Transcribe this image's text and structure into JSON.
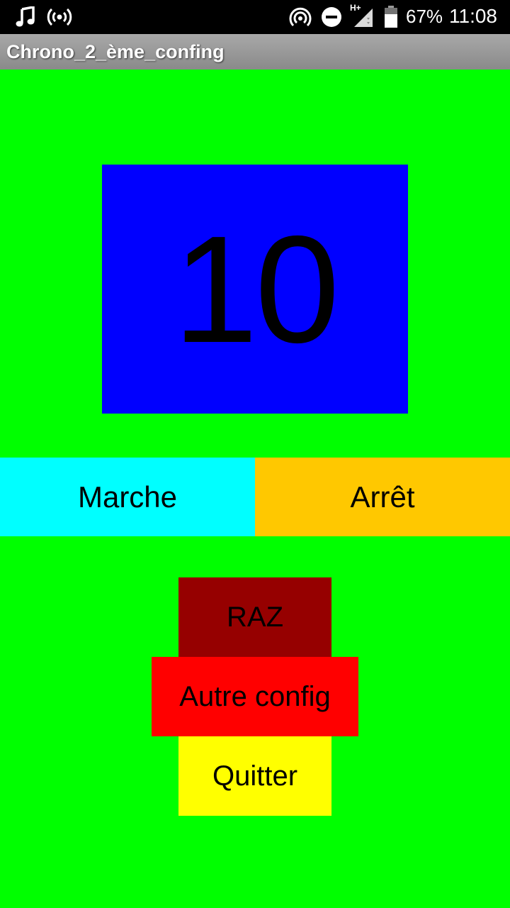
{
  "status_bar": {
    "battery_percent": "67%",
    "time": "11:08",
    "network_label": "H+",
    "icons": [
      "music-note-icon",
      "hotspot-icon",
      "nfc-icon",
      "do-not-disturb-icon",
      "signal-icon",
      "battery-icon"
    ]
  },
  "app": {
    "title": "Chrono_2_ème_confing"
  },
  "counter": {
    "value": "10",
    "color": "#0000ff"
  },
  "buttons": {
    "marche": {
      "label": "Marche",
      "color": "#00ffff"
    },
    "arret": {
      "label": "Arrêt",
      "color": "#ffc800"
    },
    "raz": {
      "label": "RAZ",
      "color": "#960000"
    },
    "autre_config": {
      "label": "Autre config",
      "color": "#ff0000"
    },
    "quitter": {
      "label": "Quitter",
      "color": "#ffff00"
    }
  },
  "background_color": "#00ff00"
}
